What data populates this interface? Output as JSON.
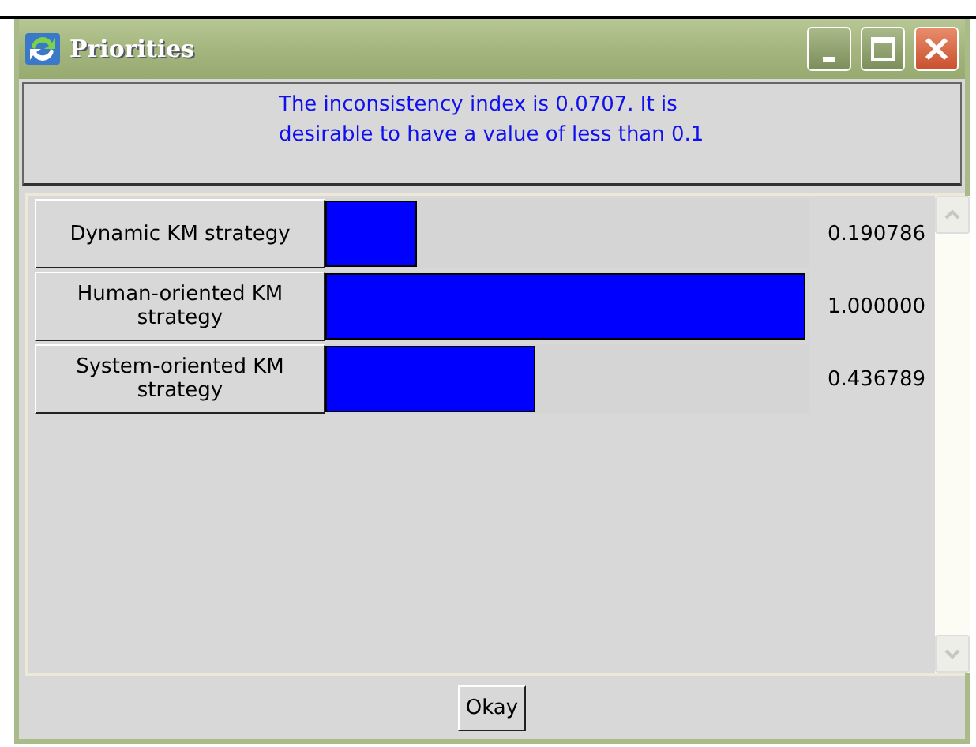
{
  "window": {
    "title": "Priorities"
  },
  "message": "The inconsistency index is 0.0707.  It is desirable to have a value of less than 0.1",
  "priorities": [
    {
      "label": "Dynamic KM strategy",
      "level": 0.190786,
      "reading": "0.190786"
    },
    {
      "label": "Human-oriented KM strategy",
      "level": 1.0,
      "reading": "1.000000"
    },
    {
      "label": "System-oriented KM strategy",
      "level": 0.436789,
      "reading": "0.436789"
    }
  ],
  "buttons": [
    "Okay"
  ]
}
